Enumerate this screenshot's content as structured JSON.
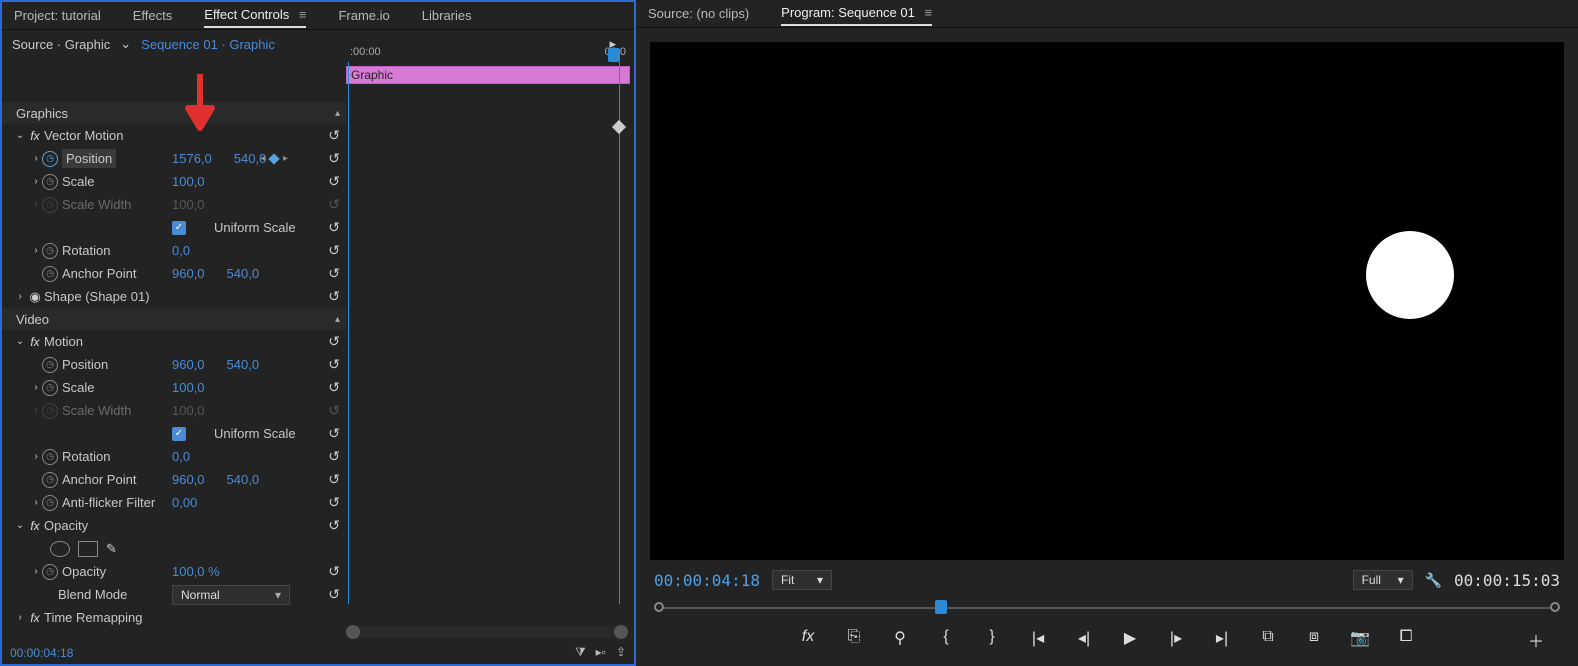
{
  "left_tabs": {
    "project": "Project: tutorial",
    "effects": "Effects",
    "effect_controls": "Effect Controls",
    "frameio": "Frame.io",
    "libraries": "Libraries"
  },
  "breadcrumb": {
    "source": "Source · Graphic",
    "seq": "Sequence 01 · Graphic"
  },
  "timeline": {
    "start": ":00:00",
    "end": "00:0",
    "clip": "Graphic"
  },
  "sections": {
    "graphics": "Graphics",
    "video": "Video"
  },
  "vector_motion": {
    "title": "Vector Motion",
    "position_label": "Position",
    "position_x": "1576,0",
    "position_y": "540,0",
    "scale_label": "Scale",
    "scale": "100,0",
    "scale_width_label": "Scale Width",
    "scale_width": "100,0",
    "uniform_label": "Uniform Scale",
    "rotation_label": "Rotation",
    "rotation": "0,0",
    "anchor_label": "Anchor Point",
    "anchor_x": "960,0",
    "anchor_y": "540,0"
  },
  "shape": {
    "label": "Shape (Shape 01)"
  },
  "motion": {
    "title": "Motion",
    "position_label": "Position",
    "position_x": "960,0",
    "position_y": "540,0",
    "scale_label": "Scale",
    "scale": "100,0",
    "scale_width_label": "Scale Width",
    "scale_width": "100,0",
    "uniform_label": "Uniform Scale",
    "rotation_label": "Rotation",
    "rotation": "0,0",
    "anchor_label": "Anchor Point",
    "anchor_x": "960,0",
    "anchor_y": "540,0",
    "antiflicker_label": "Anti-flicker Filter",
    "antiflicker": "0,00"
  },
  "opacity": {
    "title": "Opacity",
    "label": "Opacity",
    "value": "100,0 %",
    "blend_label": "Blend Mode",
    "blend_value": "Normal"
  },
  "time_remap": {
    "label": "Time Remapping"
  },
  "left_timecode": "00:00:04:18",
  "right_tabs": {
    "source": "Source: (no clips)",
    "program": "Program: Sequence 01"
  },
  "preview": {
    "tc_current": "00:00:04:18",
    "zoom": "Fit",
    "quality": "Full",
    "tc_total": "00:00:15:03"
  }
}
